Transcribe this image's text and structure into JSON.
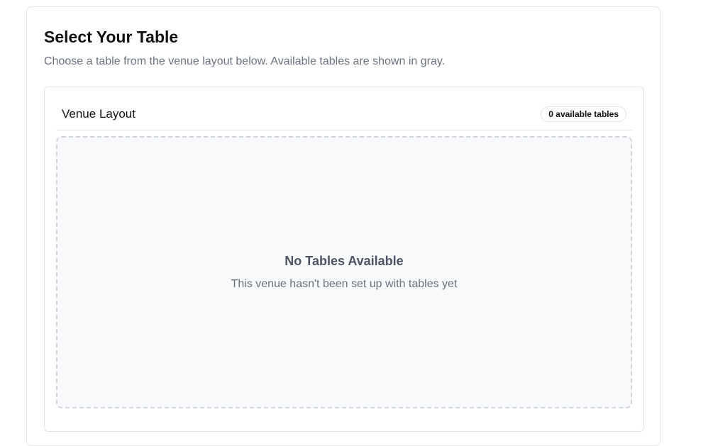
{
  "page": {
    "title": "Select Your Table",
    "subtitle": "Choose a table from the venue layout below. Available tables are shown in gray."
  },
  "venue_layout": {
    "title": "Venue Layout",
    "available_count_label": "0 available tables",
    "empty_state": {
      "title": "No Tables Available",
      "message": "This venue hasn't been set up with tables yet"
    }
  }
}
